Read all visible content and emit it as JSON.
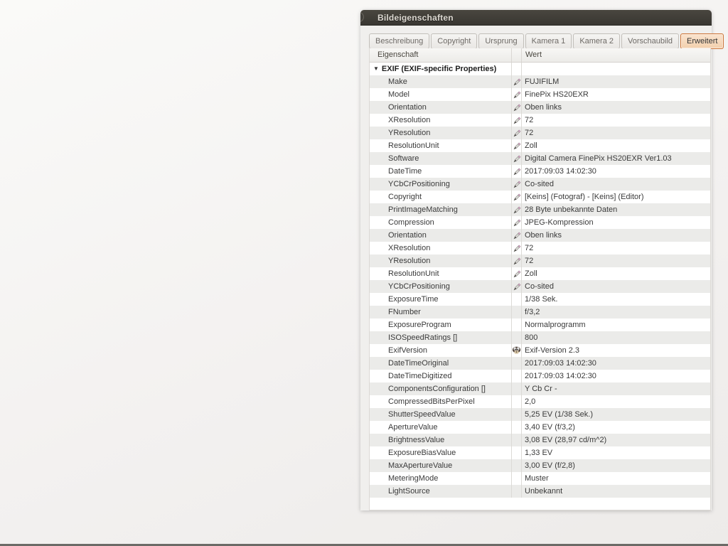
{
  "window": {
    "title": "Bildeigenschaften",
    "tabs": [
      {
        "label": "Beschreibung",
        "active": false
      },
      {
        "label": "Copyright",
        "active": false
      },
      {
        "label": "Ursprung",
        "active": false
      },
      {
        "label": "Kamera 1",
        "active": false
      },
      {
        "label": "Kamera 2",
        "active": false
      },
      {
        "label": "Vorschaubild",
        "active": false
      },
      {
        "label": "Erweitert",
        "active": true
      }
    ],
    "table": {
      "columns": {
        "property": "Eigenschaft",
        "value": "Wert"
      },
      "rows": [
        {
          "type": "group",
          "property": "EXIF (EXIF-specific Properties)",
          "value": "",
          "icon": "none",
          "expander": "▼"
        },
        {
          "type": "data",
          "property": "Make",
          "value": "FUJIFILM",
          "icon": "pencil-icon"
        },
        {
          "type": "data",
          "property": "Model",
          "value": "FinePix HS20EXR",
          "icon": "pencil-icon"
        },
        {
          "type": "data",
          "property": "Orientation",
          "value": "Oben links",
          "icon": "pencil-icon"
        },
        {
          "type": "data",
          "property": "XResolution",
          "value": "72",
          "icon": "pencil-icon"
        },
        {
          "type": "data",
          "property": "YResolution",
          "value": "72",
          "icon": "pencil-icon"
        },
        {
          "type": "data",
          "property": "ResolutionUnit",
          "value": "Zoll",
          "icon": "pencil-icon"
        },
        {
          "type": "data",
          "property": "Software",
          "value": "Digital Camera FinePix HS20EXR Ver1.03",
          "icon": "pencil-icon"
        },
        {
          "type": "data",
          "property": "DateTime",
          "value": "2017:09:03 14:02:30",
          "icon": "pencil-icon"
        },
        {
          "type": "data",
          "property": "YCbCrPositioning",
          "value": "Co-sited",
          "icon": "pencil-icon"
        },
        {
          "type": "data",
          "property": "Copyright",
          "value": "[Keins] (Fotograf) - [Keins] (Editor)",
          "icon": "pencil-icon"
        },
        {
          "type": "data",
          "property": "PrintImageMatching",
          "value": "28 Byte unbekannte Daten",
          "icon": "pencil-icon"
        },
        {
          "type": "data",
          "property": "Compression",
          "value": "JPEG-Kompression",
          "icon": "pencil-icon"
        },
        {
          "type": "data",
          "property": "Orientation",
          "value": "Oben links",
          "icon": "pencil-icon"
        },
        {
          "type": "data",
          "property": "XResolution",
          "value": "72",
          "icon": "pencil-icon"
        },
        {
          "type": "data",
          "property": "YResolution",
          "value": "72",
          "icon": "pencil-icon"
        },
        {
          "type": "data",
          "property": "ResolutionUnit",
          "value": "Zoll",
          "icon": "pencil-icon"
        },
        {
          "type": "data",
          "property": "YCbCrPositioning",
          "value": "Co-sited",
          "icon": "pencil-icon"
        },
        {
          "type": "data",
          "property": "ExposureTime",
          "value": "1/38 Sek.",
          "icon": "none"
        },
        {
          "type": "data",
          "property": "FNumber",
          "value": "f/3,2",
          "icon": "none"
        },
        {
          "type": "data",
          "property": "ExposureProgram",
          "value": "Normalprogramm",
          "icon": "none"
        },
        {
          "type": "data",
          "property": "ISOSpeedRatings []",
          "value": "800",
          "icon": "none"
        },
        {
          "type": "data",
          "property": "ExifVersion",
          "value": "Exif-Version 2.3",
          "icon": "gimp-wilber-icon"
        },
        {
          "type": "data",
          "property": "DateTimeOriginal",
          "value": "2017:09:03 14:02:30",
          "icon": "none"
        },
        {
          "type": "data",
          "property": "DateTimeDigitized",
          "value": "2017:09:03 14:02:30",
          "icon": "none"
        },
        {
          "type": "data",
          "property": "ComponentsConfiguration []",
          "value": "Y Cb Cr -",
          "icon": "none"
        },
        {
          "type": "data",
          "property": "CompressedBitsPerPixel",
          "value": "2,0",
          "icon": "none"
        },
        {
          "type": "data",
          "property": "ShutterSpeedValue",
          "value": "5,25 EV (1/38 Sek.)",
          "icon": "none"
        },
        {
          "type": "data",
          "property": "ApertureValue",
          "value": "3,40 EV (f/3,2)",
          "icon": "none"
        },
        {
          "type": "data",
          "property": "BrightnessValue",
          "value": "3,08 EV (28,97 cd/m^2)",
          "icon": "none"
        },
        {
          "type": "data",
          "property": "ExposureBiasValue",
          "value": "1,33 EV",
          "icon": "none"
        },
        {
          "type": "data",
          "property": "MaxApertureValue",
          "value": "3,00 EV (f/2,8)",
          "icon": "none"
        },
        {
          "type": "data",
          "property": "MeteringMode",
          "value": "Muster",
          "icon": "none"
        },
        {
          "type": "data",
          "property": "LightSource",
          "value": "Unbekannt",
          "icon": "none"
        }
      ]
    }
  },
  "colors": {
    "accent_orange": "#cc763a",
    "active_tab_bg": "#f6d7b8",
    "titlebar_bg": "#3c3a36",
    "titlebar_text": "#dcd8d1",
    "dialog_bg": "#f0efed",
    "row_stripe": "#ebebe9",
    "grid_line": "#dcdad6",
    "text": "#3a3a3a"
  }
}
